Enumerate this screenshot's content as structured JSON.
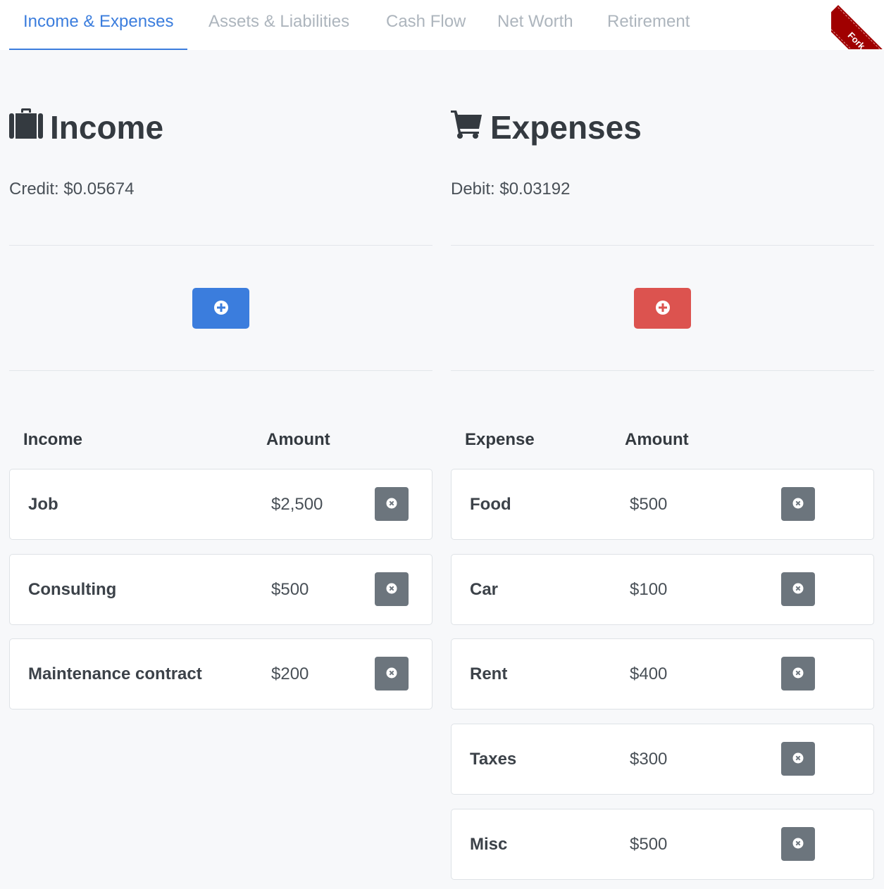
{
  "tabs": [
    {
      "label": "Income & Expenses",
      "active": true
    },
    {
      "label": "Assets & Liabilities",
      "active": false
    },
    {
      "label": "Cash Flow",
      "active": false
    },
    {
      "label": "Net Worth",
      "active": false
    },
    {
      "label": "Retirement",
      "active": false
    }
  ],
  "ribbon": {
    "label": "Fork"
  },
  "colors": {
    "primary": "#3b7ddd",
    "danger": "#dc534f",
    "secondary": "#6c757d",
    "ribbon": "#a00000"
  },
  "income": {
    "title": "Income",
    "icon": "briefcase-icon",
    "summary": "Credit: $0.05674",
    "add_icon": "plus-circle-icon",
    "columns": {
      "name": "Income",
      "amount": "Amount"
    },
    "rows": [
      {
        "name": "Job",
        "amount": "$2,500"
      },
      {
        "name": "Consulting",
        "amount": "$500"
      },
      {
        "name": "Maintenance contract",
        "amount": "$200"
      }
    ]
  },
  "expenses": {
    "title": "Expenses",
    "icon": "shopping-cart-icon",
    "summary": "Debit: $0.03192",
    "add_icon": "plus-circle-icon",
    "columns": {
      "name": "Expense",
      "amount": "Amount"
    },
    "rows": [
      {
        "name": "Food",
        "amount": "$500"
      },
      {
        "name": "Car",
        "amount": "$100"
      },
      {
        "name": "Rent",
        "amount": "$400"
      },
      {
        "name": "Taxes",
        "amount": "$300"
      },
      {
        "name": "Misc",
        "amount": "$500"
      }
    ]
  }
}
